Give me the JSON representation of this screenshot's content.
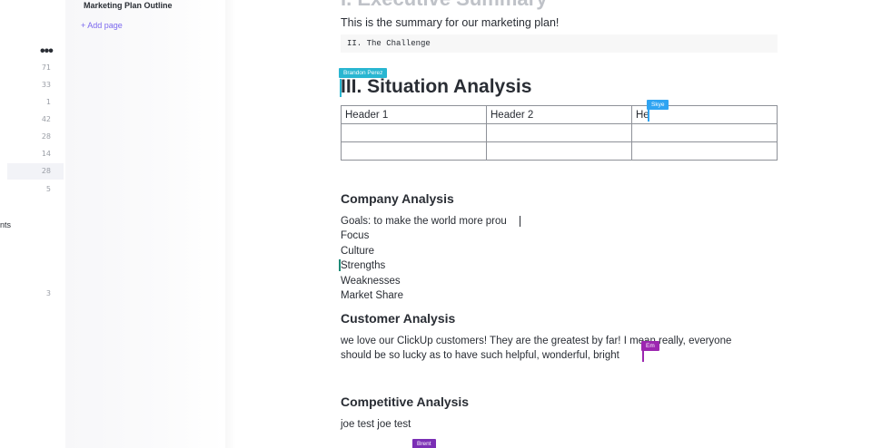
{
  "sidebar": {
    "more_icon": "more-horizontal-icon",
    "counts": [
      "71",
      "33",
      "1",
      "42",
      "28",
      "14",
      "28",
      "5",
      "3"
    ],
    "partial_label": "nts"
  },
  "page_tree": {
    "title": "Marketing Plan Outline",
    "add_page": "+ Add page"
  },
  "document": {
    "prev_heading_fragment": "I. Executive Summary",
    "summary": "This is the summary for our marketing plan!",
    "code_line": "II. The Challenge",
    "section_title": "III. Situation Analysis",
    "table": {
      "headers": [
        "Header 1",
        "Header 2",
        "He"
      ],
      "rows": [
        [
          "",
          "",
          ""
        ],
        [
          "",
          "",
          ""
        ]
      ]
    },
    "company": {
      "title": "Company Analysis",
      "lines": [
        "Goals: to make the world more prou",
        "Focus",
        "Culture",
        "Strengths",
        "Weaknesses",
        "Market Share"
      ]
    },
    "customer": {
      "title": "Customer Analysis",
      "line1": "we love our ClickUp customers! They are the greatest by far! I mean really, everyone",
      "line2": "should be so lucky as to have such helpful, wonderful, bright"
    },
    "competitive": {
      "title": "Competitive Analysis",
      "line": "joe test joe test"
    }
  },
  "collaborators": {
    "brandon": {
      "name": "Brandon Perez",
      "color": "#29b6d1"
    },
    "skye": {
      "name": "Skye",
      "color": "#2fa4f2"
    },
    "em": {
      "name": "Em",
      "color": "#9c27b0"
    },
    "brent": {
      "name": "Brent",
      "color": "#7b2fb5"
    }
  }
}
